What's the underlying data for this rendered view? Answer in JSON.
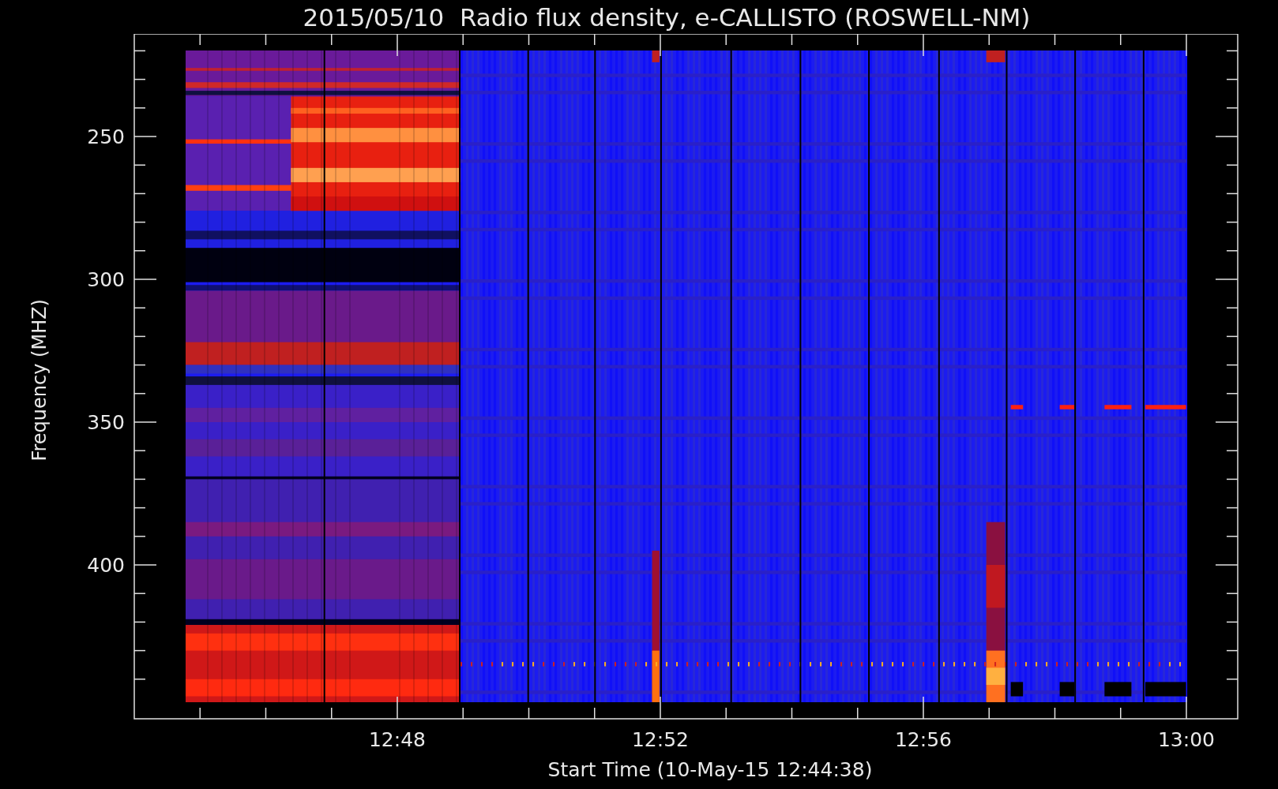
{
  "title": "2015/05/10  Radio flux density, e-CALLISTO (ROSWELL-NM)",
  "y_axis": {
    "label": "Frequency (MHZ)",
    "ticks": [
      "250",
      "300",
      "350",
      "400"
    ]
  },
  "x_axis": {
    "label": "Start Time (10-May-15 12:44:38)",
    "ticks": [
      "12:48",
      "12:52",
      "12:56",
      "13:00"
    ]
  }
}
